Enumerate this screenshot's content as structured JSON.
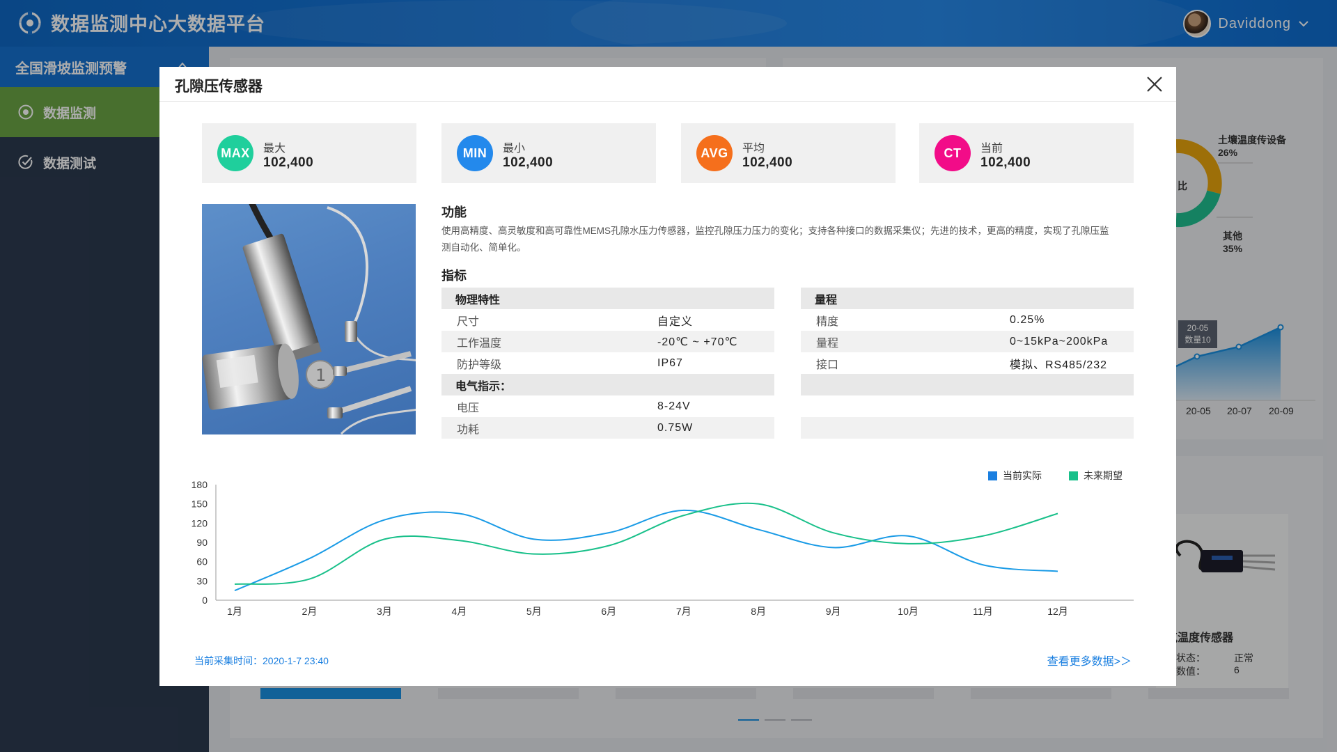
{
  "header": {
    "title": "数据监测中心大数据平台",
    "username": "Daviddong"
  },
  "sidebar": {
    "section_label": "全国滑坡监测预警",
    "items": [
      {
        "label": "数据监测",
        "active": true
      },
      {
        "label": "数据测试",
        "active": false
      }
    ]
  },
  "background": {
    "donut_labels": [
      {
        "name": "土壤温度传设备",
        "pct": "26%"
      },
      {
        "name": "其他",
        "pct": "35%"
      }
    ],
    "donut_center": "比",
    "tooltip": {
      "line1": "20-05",
      "line2": "数量10"
    },
    "xticks": [
      "20-05",
      "20-07",
      "20-09"
    ],
    "card": {
      "title": "气温度传感器",
      "status_label": "前状态：",
      "status_value": "正常",
      "value_label": "前数值：",
      "value_value": "6"
    }
  },
  "modal": {
    "title": "孔隙压传感器",
    "stats": [
      {
        "badge": "MAX",
        "label": "最大",
        "value": "102,400",
        "color": "#1fcf9c"
      },
      {
        "badge": "MIN",
        "label": "最小",
        "value": "102,400",
        "color": "#2389ec"
      },
      {
        "badge": "AVG",
        "label": "平均",
        "value": "102,400",
        "color": "#f56f1c"
      },
      {
        "badge": "CT",
        "label": "当前",
        "value": "102,400",
        "color": "#f20c88"
      }
    ],
    "function_title": "功能",
    "function_desc": "使用高精度、高灵敏度和高可靠性MEMS孔隙水压力传感器，监控孔隙压力压力的变化；支持各种接口的数据采集仪；先进的技术，更高的精度，实现了孔隙压监测自动化、简单化。",
    "index_title": "指标",
    "spec_left": {
      "physical_head": "物理特性",
      "physical": [
        {
          "k": "尺寸",
          "v": "自定义"
        },
        {
          "k": "工作温度",
          "v": "-20℃ ~ +70℃"
        },
        {
          "k": "防护等级",
          "v": "IP67"
        }
      ],
      "electric_head": "电气指示：",
      "electric": [
        {
          "k": "电压",
          "v": "8-24V"
        },
        {
          "k": "功耗",
          "v": "0.75W"
        }
      ]
    },
    "spec_right": {
      "head": "量程",
      "rows": [
        {
          "k": "精度",
          "v": "0.25%"
        },
        {
          "k": "量程",
          "v": "0~15kPa~200kPa"
        },
        {
          "k": "接口",
          "v": "模拟、RS485/232"
        }
      ]
    },
    "footer": {
      "time_label": "当前采集时间：2020-1-7   23:40",
      "more_link": "查看更多数据>＞"
    }
  },
  "chart_data": {
    "type": "line",
    "categories": [
      "1月",
      "2月",
      "3月",
      "4月",
      "5月",
      "6月",
      "7月",
      "8月",
      "9月",
      "10月",
      "11月",
      "12月"
    ],
    "ylim": [
      0,
      180
    ],
    "yticks": [
      0,
      30,
      60,
      90,
      120,
      150,
      180
    ],
    "series": [
      {
        "name": "当前实际",
        "color": "#1a9be6",
        "values": [
          15,
          65,
          125,
          135,
          95,
          105,
          140,
          110,
          82,
          100,
          55,
          45
        ]
      },
      {
        "name": "未来期望",
        "color": "#19c08a",
        "values": [
          25,
          33,
          95,
          93,
          72,
          85,
          132,
          150,
          105,
          88,
          100,
          135
        ]
      }
    ]
  }
}
